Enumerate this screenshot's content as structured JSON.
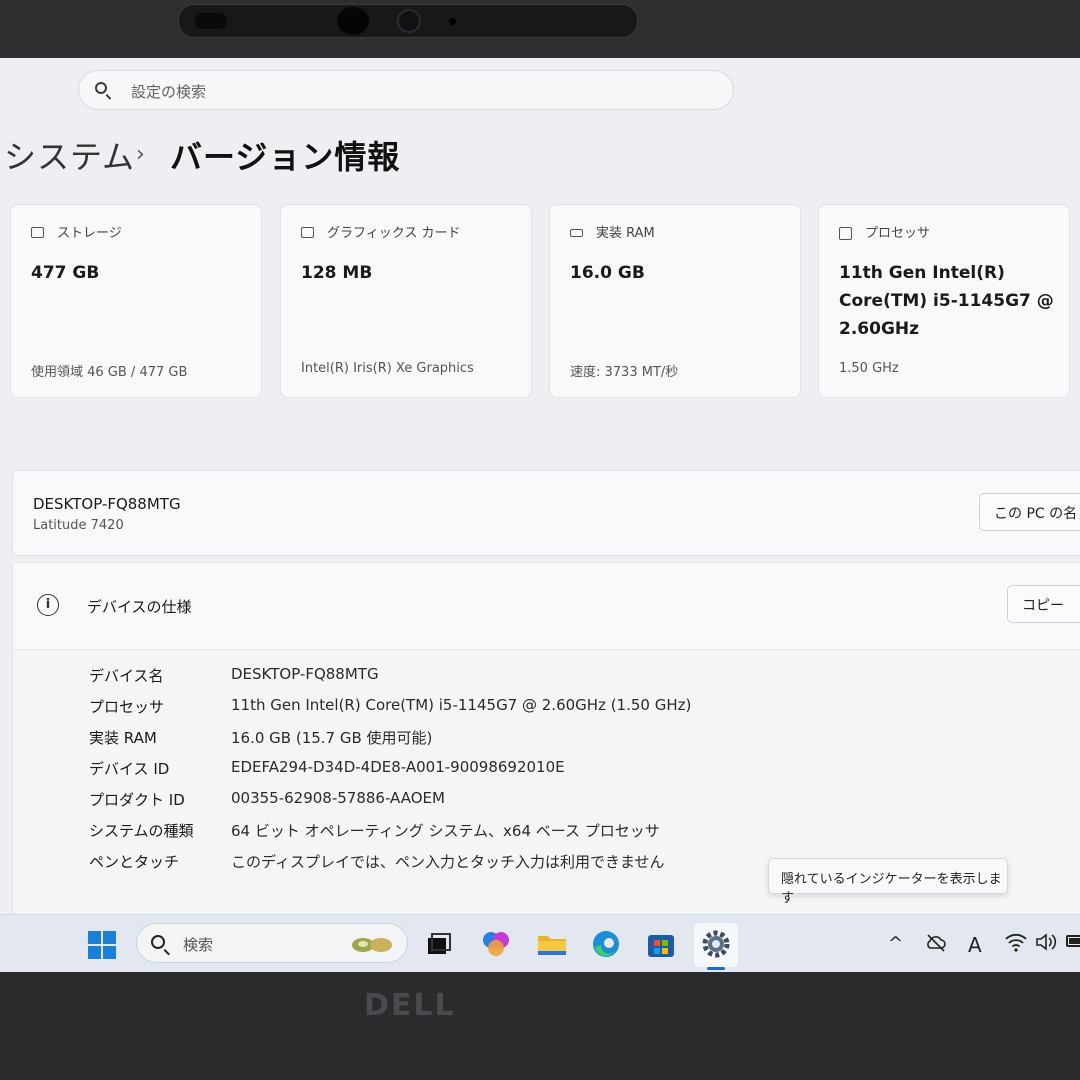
{
  "search": {
    "placeholder": "設定の検索"
  },
  "breadcrumb": {
    "parent": "システム",
    "separator": "›",
    "current": "バージョン情報"
  },
  "cards": [
    {
      "label": "ストレージ",
      "value": "477 GB",
      "sub": "使用領域 46 GB / 477 GB",
      "icon": "storage-icon"
    },
    {
      "label": "グラフィックス カード",
      "value": "128 MB",
      "sub": "Intel(R) Iris(R) Xe Graphics",
      "icon": "display-icon"
    },
    {
      "label": "実装 RAM",
      "value": "16.0 GB",
      "sub": "速度: 3733 MT/秒",
      "icon": "memory-icon"
    },
    {
      "label": "プロセッサ",
      "value": "11th Gen Intel(R) Core(TM) i5-1145G7 @ 2.60GHz",
      "sub": "1.50 GHz",
      "icon": "processor-icon"
    }
  ],
  "pc": {
    "name": "DESKTOP-FQ88MTG",
    "model": "Latitude 7420",
    "rename_label": "この PC の名"
  },
  "spec": {
    "title": "デバイスの仕様",
    "copy_label": "コピー",
    "rows": [
      {
        "label": "デバイス名",
        "value": "DESKTOP-FQ88MTG"
      },
      {
        "label": "プロセッサ",
        "value": "11th Gen Intel(R) Core(TM) i5-1145G7 @ 2.60GHz (1.50 GHz)"
      },
      {
        "label": "実装 RAM",
        "value": "16.0 GB (15.7 GB 使用可能)"
      },
      {
        "label": "デバイス ID",
        "value": "EDEFA294-D34D-4DE8-A001-90098692010E"
      },
      {
        "label": "プロダクト ID",
        "value": "00355-62908-57886-AAOEM"
      },
      {
        "label": "システムの種類",
        "value": "64 ビット オペレーティング システム、x64 ベース プロセッサ"
      },
      {
        "label": "ペンとタッチ",
        "value": "このディスプレイでは、ペン入力とタッチ入力は利用できません"
      }
    ]
  },
  "tooltip": "隠れているインジケーターを表示します",
  "taskbar": {
    "search_placeholder": "検索",
    "apps": [
      "start-icon",
      "task-view-icon",
      "copilot-icon",
      "file-explorer-icon",
      "edge-icon",
      "store-icon",
      "settings-icon"
    ],
    "tray": {
      "chevron": "^",
      "ime": "A"
    }
  },
  "brand": "DELL",
  "colors": {
    "accent": "#1a6fc4",
    "screen_bg": "#edeff2",
    "bezel": "#2e2f31"
  }
}
